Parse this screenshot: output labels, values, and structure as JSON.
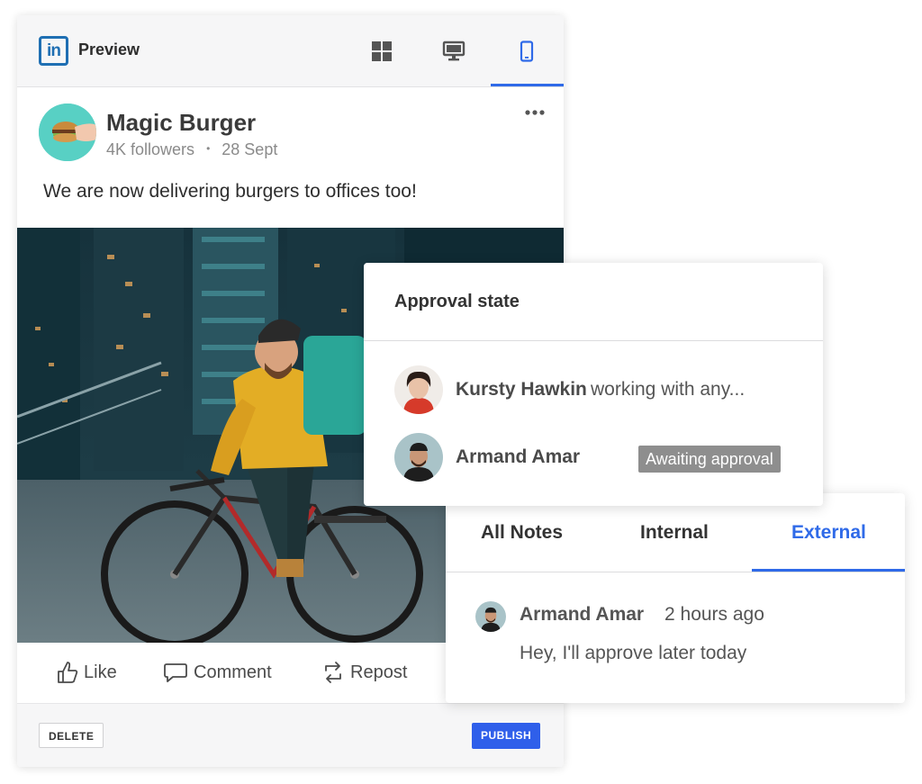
{
  "preview": {
    "logo_text": "in",
    "title": "Preview",
    "view_icons": [
      "grid-icon",
      "desktop-icon",
      "mobile-icon"
    ],
    "active_view": "mobile",
    "post": {
      "author": "Magic Burger",
      "followers": "4K followers",
      "separator": "•",
      "date": "28 Sept",
      "text": "We are now delivering burgers to offices too!"
    },
    "actions": [
      {
        "label": "Like",
        "icon": "thumbs-up-icon"
      },
      {
        "label": "Comment",
        "icon": "comment-icon"
      },
      {
        "label": "Repost",
        "icon": "repost-icon"
      }
    ],
    "delete_label": "DELETE",
    "publish_label": "PUBLISH"
  },
  "approval": {
    "title": "Approval state",
    "rows": [
      {
        "name": "Kursty Hawkin",
        "note": "working with any..."
      },
      {
        "name": "Armand Amar",
        "status": "Awaiting approval"
      }
    ]
  },
  "notes": {
    "tabs": [
      {
        "label": "All Notes"
      },
      {
        "label": "Internal"
      },
      {
        "label": "External",
        "active": true
      }
    ],
    "items": [
      {
        "author": "Armand Amar",
        "time": "2 hours ago",
        "text": "Hey, I'll approve later today"
      }
    ]
  },
  "colors": {
    "accent": "#2f6ae8",
    "linkedin": "#1f6fb3",
    "publish": "#2f5fea",
    "badge": "#8e8e8e"
  }
}
